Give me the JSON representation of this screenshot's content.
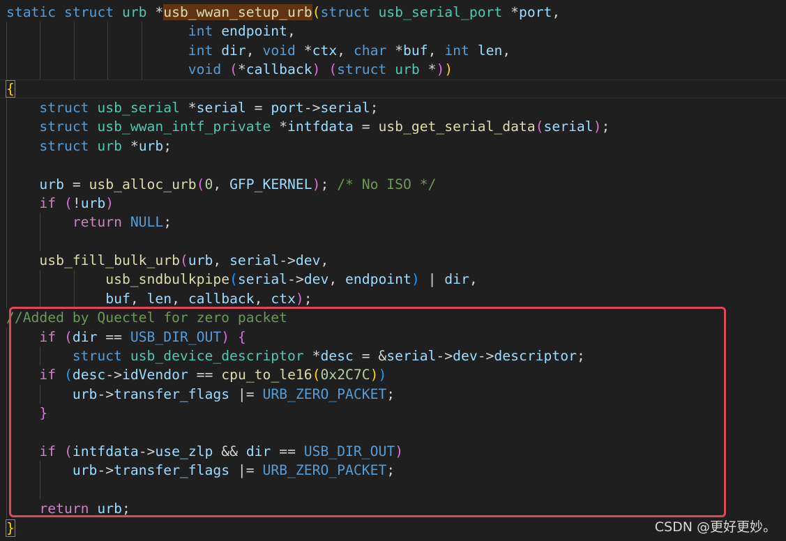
{
  "editor": {
    "lines": [
      "static struct urb *usb_wwan_setup_urb(struct usb_serial_port *port,",
      "                      int endpoint,",
      "                      int dir, void *ctx, char *buf, int len,",
      "                      void (*callback) (struct urb *))",
      "{",
      "    struct usb_serial *serial = port->serial;",
      "    struct usb_wwan_intf_private *intfdata = usb_get_serial_data(serial);",
      "    struct urb *urb;",
      "",
      "    urb = usb_alloc_urb(0, GFP_KERNEL); /* No ISO */",
      "    if (!urb)",
      "        return NULL;",
      "",
      "    usb_fill_bulk_urb(urb, serial->dev,",
      "            usb_sndbulkpipe(serial->dev, endpoint) | dir,",
      "            buf, len, callback, ctx);",
      "//Added by Quectel for zero packet",
      "    if (dir == USB_DIR_OUT) {",
      "        struct usb_device_descriptor *desc = &serial->dev->descriptor;",
      "    if (desc->idVendor == cpu_to_le16(0x2C7C))",
      "        urb->transfer_flags |= URB_ZERO_PACKET;",
      "    }",
      "",
      "    if (intfdata->use_zlp && dir == USB_DIR_OUT)",
      "        urb->transfer_flags |= URB_ZERO_PACKET;",
      "",
      "    return urb;",
      "}"
    ]
  },
  "watermark": "CSDN @更好更妙。",
  "colors": {
    "background": "#1f1f1f",
    "keyword": "#569cd6",
    "control": "#c586c0",
    "function": "#dcdcaa",
    "variable": "#9cdcfe",
    "comment": "#6a9955",
    "number": "#b5cea8",
    "highlight_border": "#e0475a"
  }
}
